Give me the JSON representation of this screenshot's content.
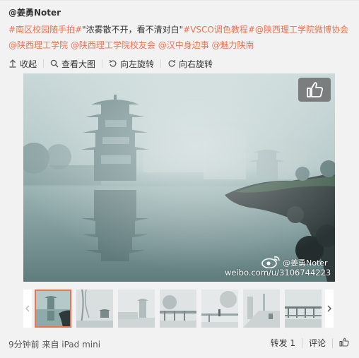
{
  "post": {
    "author": "@姜勇Noter",
    "text_segments": [
      {
        "text": "#南区校园随手拍#",
        "hl": true
      },
      {
        "text": "\"浓雾散不开，看不清对白\"",
        "hl": false
      },
      {
        "text": "#VSCO调色教程#",
        "hl": true
      },
      {
        "text": "@陕西理工学院微博协会",
        "hl": true
      },
      {
        "text": " ",
        "hl": false
      },
      {
        "text": "@陕西理工学院",
        "hl": true
      },
      {
        "text": " ",
        "hl": false
      },
      {
        "text": "@陕西理工学院校友会",
        "hl": true
      },
      {
        "text": " ",
        "hl": false
      },
      {
        "text": "@汉中身边事",
        "hl": true
      },
      {
        "text": " ",
        "hl": false
      },
      {
        "text": "@魅力陕南",
        "hl": true
      }
    ]
  },
  "toolbar": {
    "collapse_label": "收起",
    "view_large_label": "查看大图",
    "rotate_left_label": "向左旋转",
    "rotate_right_label": "向右旋转"
  },
  "image": {
    "watermark_name": "@姜勇Noter",
    "watermark_url": "weibo.com/u/3106744223"
  },
  "footer": {
    "meta": "9分钟前 来自 iPad mini",
    "forward_label": "转发 1",
    "comment_label": "评论"
  },
  "colors": {
    "accent": "#eb7350",
    "background": "#f2f2f2"
  },
  "icons": {
    "collapse": "arrow-up-icon",
    "view_large": "search-icon",
    "rotate_left": "rotate-left-icon",
    "rotate_right": "rotate-right-icon",
    "like": "thumbs-up-icon",
    "weibo": "weibo-logo-icon"
  }
}
